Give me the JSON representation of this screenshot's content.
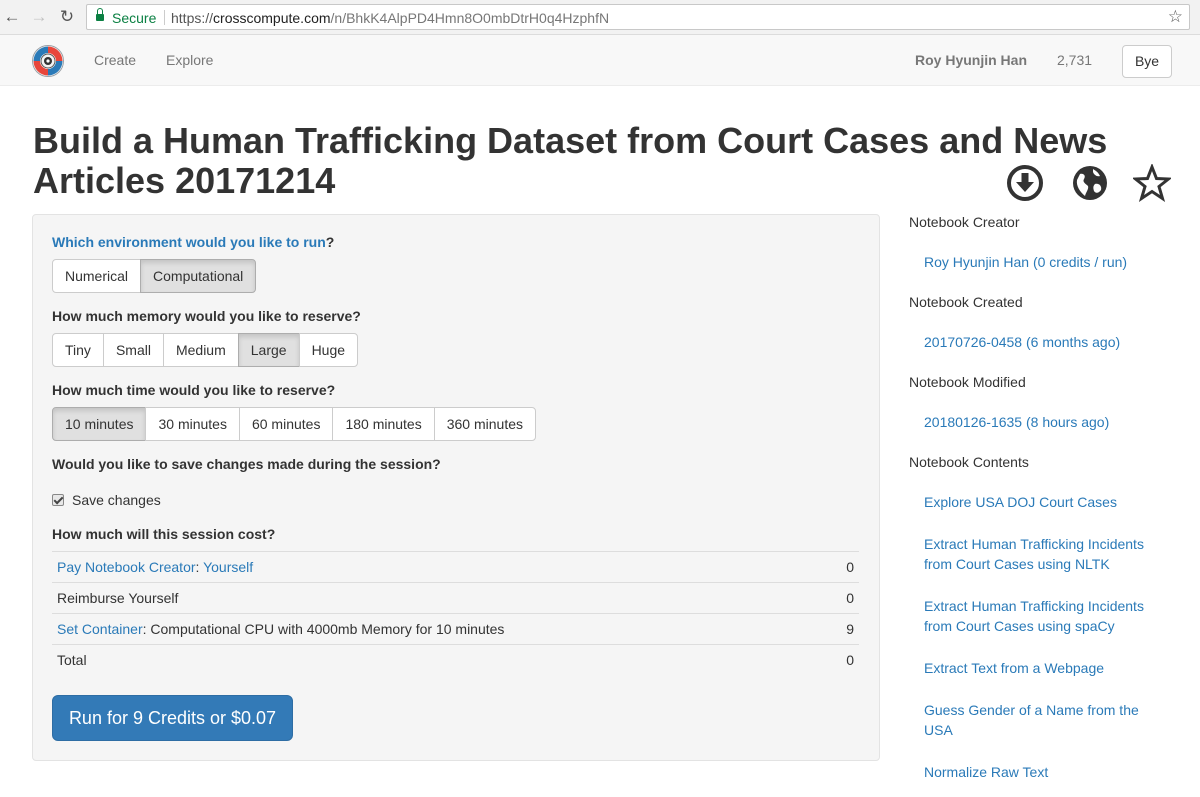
{
  "browser": {
    "secure_label": "Secure",
    "url_scheme": "https://",
    "url_domain": "crosscompute.com",
    "url_path": "/n/BhkK4AlpPD4Hmn8O0mbDtrH0q4HzphfN"
  },
  "navbar": {
    "create_label": "Create",
    "explore_label": "Explore",
    "user_name": "Roy Hyunjin Han",
    "credits": "2,731",
    "bye_label": "Bye"
  },
  "page": {
    "title": "Build a Human Trafficking Dataset from Court Cases and News Articles 20171214"
  },
  "form": {
    "environment": {
      "question_link": "Which environment would you like to run",
      "question_suffix": "?",
      "options": [
        "Numerical",
        "Computational"
      ],
      "selected": "Computational"
    },
    "memory": {
      "question": "How much memory would you like to reserve?",
      "options": [
        "Tiny",
        "Small",
        "Medium",
        "Large",
        "Huge"
      ],
      "selected": "Large"
    },
    "time": {
      "question": "How much time would you like to reserve?",
      "options": [
        "10 minutes",
        "30 minutes",
        "60 minutes",
        "180 minutes",
        "360 minutes"
      ],
      "selected": "10 minutes"
    },
    "save": {
      "question": "Would you like to save changes made during the session?",
      "checkbox_label": "Save changes",
      "checked": true
    },
    "cost": {
      "question": "How much will this session cost?",
      "rows": [
        {
          "link": "Pay Notebook Creator",
          "sep": ": ",
          "link2": "Yourself",
          "amount": "0"
        },
        {
          "text": "Reimburse Yourself",
          "amount": "0"
        },
        {
          "link": "Set Container",
          "text": ": Computational CPU with 4000mb Memory for 10 minutes",
          "amount": "9"
        },
        {
          "text": "Total",
          "amount": "0"
        }
      ]
    },
    "run_label": "Run for 9 Credits or $0.07"
  },
  "sidebar": {
    "creator_heading": "Notebook Creator",
    "creator_value": "Roy Hyunjin Han (0 credits / run)",
    "created_heading": "Notebook Created",
    "created_value": "20170726-0458 (6 months ago)",
    "modified_heading": "Notebook Modified",
    "modified_value": "20180126-1635 (8 hours ago)",
    "contents_heading": "Notebook Contents",
    "contents": [
      "Explore USA DOJ Court Cases",
      "Extract Human Trafficking Incidents from Court Cases using NLTK",
      "Extract Human Trafficking Incidents from Court Cases using spaCy",
      "Extract Text from a Webpage",
      "Guess Gender of a Name from the USA",
      "Normalize Raw Text"
    ]
  },
  "icons": {
    "back": "arrow-left-icon",
    "forward": "arrow-right-icon",
    "reload": "reload-icon",
    "lock": "lock-icon",
    "bookmark": "star-outline-icon",
    "download": "download-circle-icon",
    "globe": "globe-icon",
    "star": "star-icon"
  },
  "colors": {
    "link": "#2a7ab8",
    "primary_button": "#337ab7",
    "secure_green": "#0b8043"
  }
}
